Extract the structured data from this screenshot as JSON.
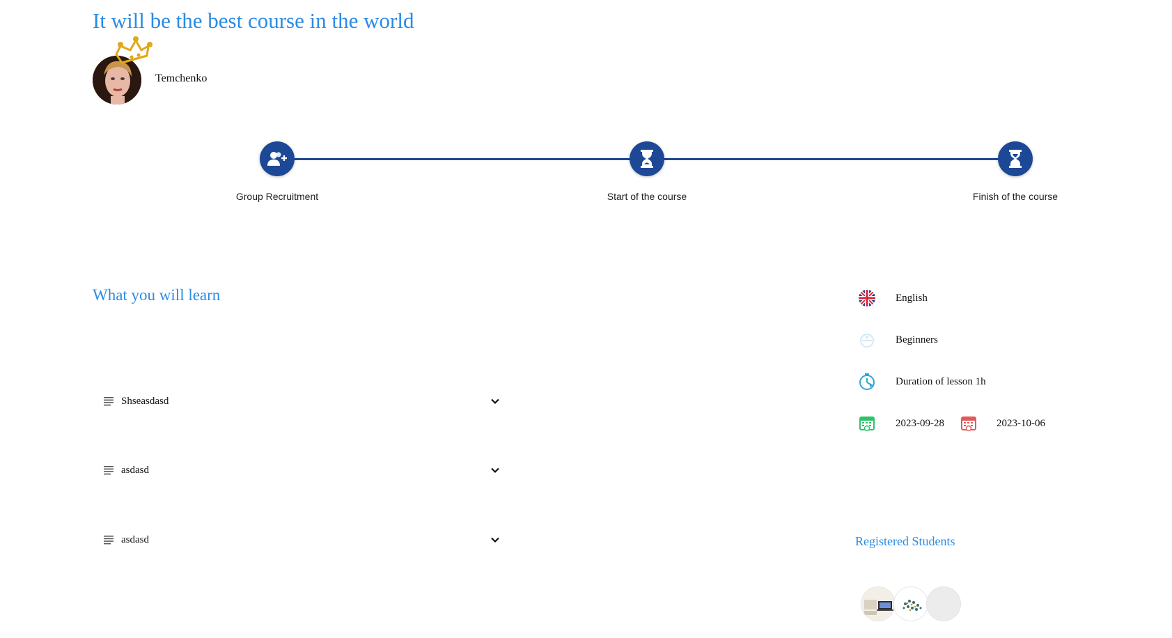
{
  "course": {
    "title": "It will be the best course in the world",
    "author": "Temchenko"
  },
  "timeline": {
    "steps": [
      {
        "label": "Group Recruitment",
        "icon": "user-plus-icon"
      },
      {
        "label": "Start of the course",
        "icon": "hourglass-icon"
      },
      {
        "label": "Finish of the course",
        "icon": "hourglass-icon"
      }
    ],
    "color": "#1d4896"
  },
  "learn": {
    "title": "What you will learn",
    "items": [
      {
        "label": "Shseasdasd"
      },
      {
        "label": "asdasd"
      },
      {
        "label": "asdasd"
      }
    ]
  },
  "info": {
    "language": "English",
    "level": "Beginners",
    "duration": "Duration of lesson 1h",
    "start_date": "2023-09-28",
    "end_date": "2023-10-06"
  },
  "students": {
    "title": "Registered Students",
    "count": 3
  },
  "colors": {
    "accent": "#2b8be5",
    "timeline": "#1d4896",
    "crown": "#e0a81a",
    "start_calendar": "#2ec26a",
    "end_calendar": "#e05a5a"
  }
}
